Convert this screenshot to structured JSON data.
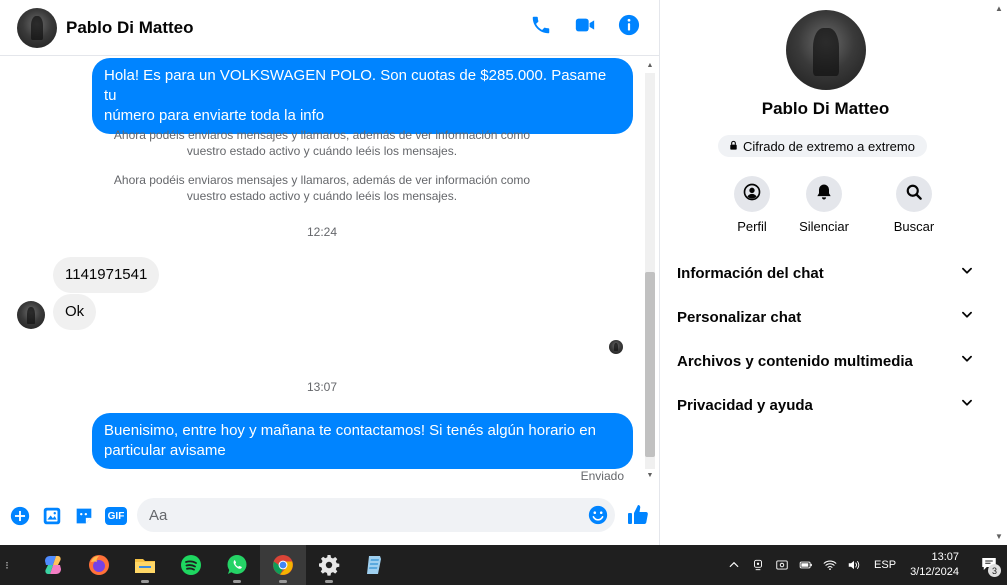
{
  "chat": {
    "contact_name": "Pablo Di Matteo",
    "header_icons": [
      "phone-icon",
      "video-icon",
      "info-icon"
    ],
    "messages": {
      "out_1": {
        "line1": "Hola! Es para un VOLKSWAGEN POLO. Son cuotas de $285.000. Pasame tu",
        "line2": "número para enviarte toda la info"
      },
      "sys_1": {
        "line1": "Ahora podéis enviaros mensajes y llamaros, además de ver información como",
        "line2": "vuestro estado activo y cuándo leéis los mensajes."
      },
      "sys_2": {
        "line1": "Ahora podéis enviaros mensajes y llamaros, además de ver información como",
        "line2": "vuestro estado activo y cuándo leéis los mensajes."
      },
      "time_1": "12:24",
      "in_1": "1141971541",
      "in_2": "Ok",
      "time_2": "13:07",
      "out_2": {
        "line1": "Buenisimo, entre hoy y mañana te contactamos! Si tenés algún horario en",
        "line2": "particular avisame"
      },
      "status": "Enviado"
    },
    "composer": {
      "placeholder": "Aa"
    }
  },
  "info_panel": {
    "name": "Pablo Di Matteo",
    "encryption_badge": "Cifrado de extremo a extremo",
    "actions": [
      {
        "label": "Perfil",
        "icon": "profile-icon"
      },
      {
        "label": "Silenciar",
        "icon": "bell-icon"
      },
      {
        "label": "Buscar",
        "icon": "search-icon"
      }
    ],
    "sections": [
      "Información del chat",
      "Personalizar chat",
      "Archivos y contenido multimedia",
      "Privacidad y ayuda"
    ]
  },
  "taskbar": {
    "apps": [
      "copilot-icon",
      "firefox-icon",
      "file-explorer-icon",
      "spotify-icon",
      "whatsapp-icon",
      "chrome-icon",
      "settings-icon",
      "notepad-icon"
    ],
    "language": "ESP",
    "time": "13:07",
    "date": "3/12/2024",
    "notification_count": "3"
  },
  "colors": {
    "messenger_blue": "#0084ff",
    "incoming_bubble": "#f0f0f0",
    "taskbar": "#1f1f1f"
  }
}
